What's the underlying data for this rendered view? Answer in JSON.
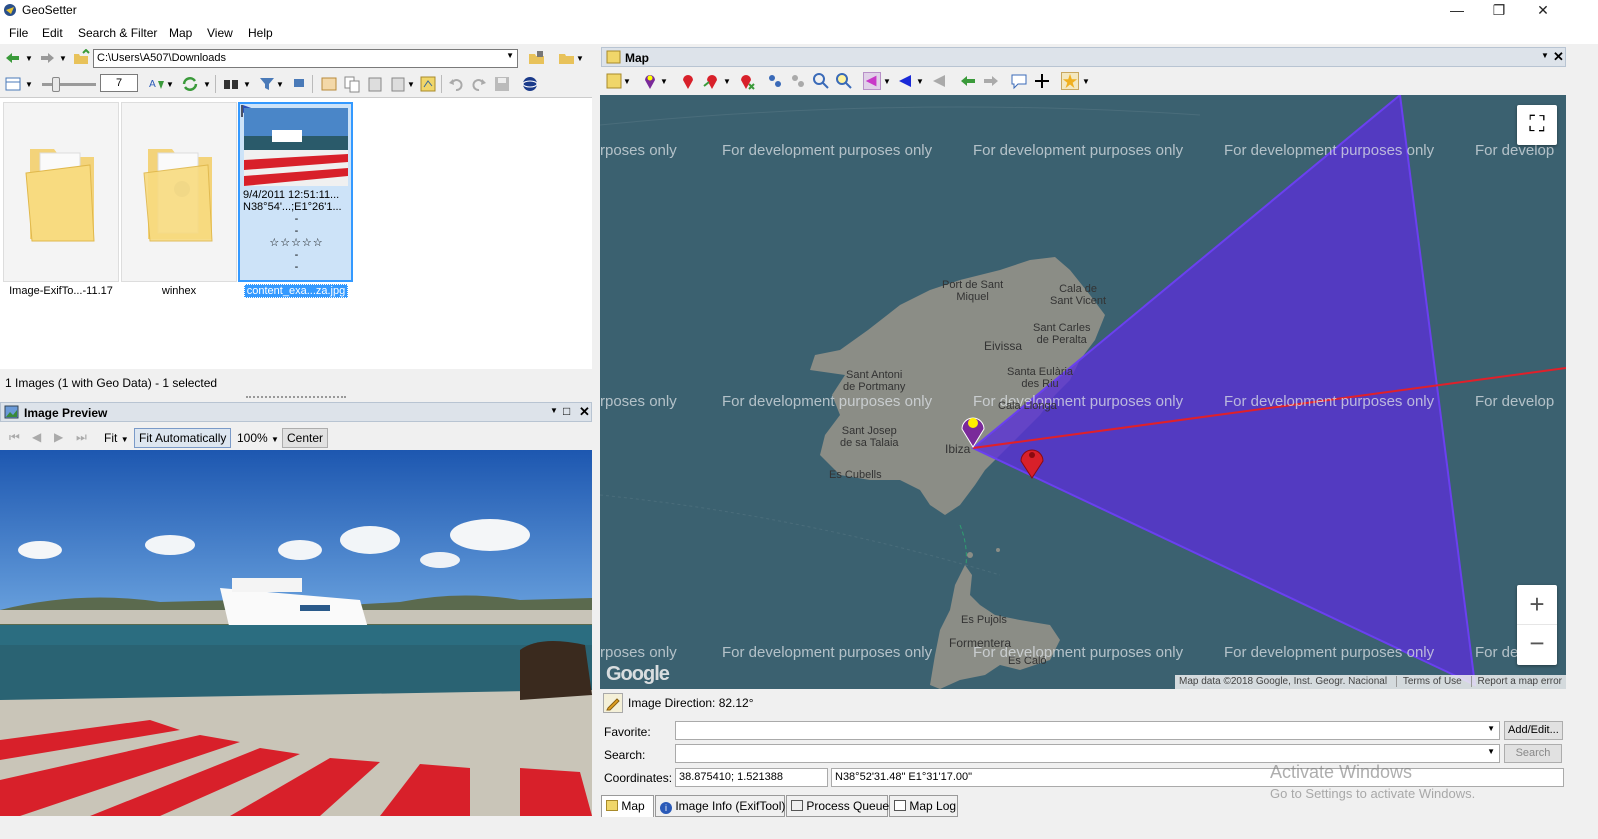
{
  "app": {
    "title": "GeoSetter"
  },
  "window_buttons": {
    "minimize": "—",
    "maximize": "❐",
    "close": "✕"
  },
  "menu": [
    "File",
    "Edit",
    "Search & Filter",
    "Map",
    "View",
    "Help"
  ],
  "path": {
    "value": "C:\\Users\\A507\\Downloads"
  },
  "thumb_size": {
    "value": "7"
  },
  "thumbnails": [
    {
      "caption": "Image-ExifTo...-11.17",
      "type": "folder"
    },
    {
      "caption": "winhex",
      "type": "folder-gear"
    },
    {
      "caption": "content_exa...za.jpg",
      "type": "image",
      "selected": true,
      "info": [
        "9/4/2011 12:51:11...",
        "N38°54'...;E1°26'1...",
        "-",
        "-",
        "☆☆☆☆☆",
        "-",
        "-"
      ]
    }
  ],
  "browser_status": "1 Images (1 with Geo Data) - 1 selected",
  "preview": {
    "title": "Image Preview",
    "fit_label": "Fit",
    "fit_auto_label": "Fit Automatically",
    "zoom": "100%",
    "center_label": "Center"
  },
  "map_panel": {
    "title": "Map",
    "watermark": "For development purposes only",
    "watermark_left": "rposes only",
    "watermark_right": "For develop",
    "places": [
      {
        "name": "Port de Sant\nMiquel"
      },
      {
        "name": "Cala de\nSant Vicent"
      },
      {
        "name": "Sant Carles\nde Peralta"
      },
      {
        "name": "Eivissa"
      },
      {
        "name": "Sant Antoni\nde Portmany"
      },
      {
        "name": "Santa Eulària\ndes Riu"
      },
      {
        "name": "Cala Llonga"
      },
      {
        "name": "Sant Josep\nde sa Talaia"
      },
      {
        "name": "Ibiza"
      },
      {
        "name": "Es Cubells"
      },
      {
        "name": "Es Pujols"
      },
      {
        "name": "Formentera"
      },
      {
        "name": "Es Caló"
      }
    ],
    "google_logo": "Google",
    "attribution": [
      "Map data ©2018 Google, Inst. Geogr. Nacional",
      "Terms of Use",
      "Report a map error"
    ],
    "zoom_in": "+",
    "zoom_out": "−",
    "fullscreen_icon": "fullscreen-icon"
  },
  "image_direction": "Image Direction: 82.12°",
  "fields": {
    "favorite_label": "Favorite:",
    "favorite_value": "",
    "add_edit_label": "Add/Edit...",
    "search_label": "Search:",
    "search_value": "",
    "search_button": "Search",
    "coordinates_label": "Coordinates:",
    "coordinates_decimal": "38.875410; 1.521388",
    "coordinates_dms": "N38°52'31.48\" E1°31'17.00\""
  },
  "bottom_tabs": [
    "Map",
    "Image Info (ExifTool)",
    "Process Queue",
    "Map Log"
  ],
  "activate_windows": {
    "line1": "Activate Windows",
    "line2": "Go to Settings to activate Windows."
  },
  "colors": {
    "accent": "#3399ff",
    "map_water": "#3b6170",
    "land": "#8d8f88",
    "polygon": "#5a30d8",
    "direction_line": "#e0202a"
  }
}
